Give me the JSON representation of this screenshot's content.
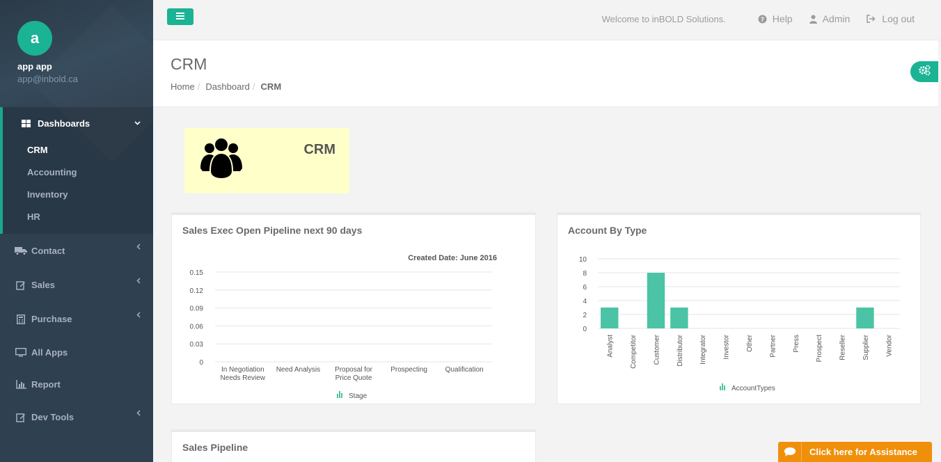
{
  "profile": {
    "initial": "a",
    "name": "app app",
    "email": "app@inbold.ca"
  },
  "sidebar": {
    "dashboards_label": "Dashboards",
    "sub_items": [
      "CRM",
      "Accounting",
      "Inventory",
      "HR"
    ],
    "items": [
      {
        "label": "Contact",
        "icon": "truck-icon",
        "chevron": true
      },
      {
        "label": "Sales",
        "icon": "edit-icon",
        "chevron": true
      },
      {
        "label": "Purchase",
        "icon": "calculator-icon",
        "chevron": true
      },
      {
        "label": "All Apps",
        "icon": "desktop-icon",
        "chevron": false
      },
      {
        "label": "Report",
        "icon": "bar-chart-icon",
        "chevron": false
      },
      {
        "label": "Dev Tools",
        "icon": "edit-icon",
        "chevron": true
      }
    ]
  },
  "topbar": {
    "welcome": "Welcome to inBOLD Solutions.",
    "help": "Help",
    "admin": "Admin",
    "logout": "Log out"
  },
  "heading": {
    "title": "CRM",
    "breadcrumb": [
      "Home",
      "Dashboard",
      "CRM"
    ]
  },
  "crm_widget": {
    "label": "CRM"
  },
  "panels": {
    "pipeline_title": "Sales Exec Open Pipeline next 90 days",
    "account_title": "Account By Type",
    "sales_pipeline_title": "Sales Pipeline"
  },
  "assist": {
    "label": "Click here for Assistance"
  },
  "colors": {
    "accent": "#1ab394",
    "sidebar": "#2f4050",
    "bar": "#4bc4a5",
    "assist": "#f0900a",
    "widget_bg": "#ffffc9"
  },
  "chart_data": [
    {
      "type": "bar",
      "title": "Sales Exec Open Pipeline next 90 days",
      "subtitle": "Created Date: June 2016",
      "categories": [
        "In Negotiation Needs Review",
        "Need Analysis",
        "Proposal for Price Quote",
        "Prospecting",
        "Qualification"
      ],
      "category_lines": [
        [
          "In Negotiation",
          "Needs Review"
        ],
        [
          "Need Analysis"
        ],
        [
          "Proposal for",
          "Price Quote"
        ],
        [
          "Prospecting"
        ],
        [
          "Qualification"
        ]
      ],
      "values": [
        0,
        0,
        0,
        0,
        0
      ],
      "yticks": [
        "0",
        "0.03",
        "0.06",
        "0.09",
        "0.12",
        "0.15"
      ],
      "ylim": [
        0,
        0.15
      ],
      "legend": "Stage",
      "grid": true
    },
    {
      "type": "bar",
      "title": "Account By Type",
      "categories": [
        "Analyst",
        "Competitor",
        "Customer",
        "Distributor",
        "Integrator",
        "Investor",
        "Other",
        "Partner",
        "Press",
        "Prospect",
        "Reseller",
        "Supplier",
        "Vendor"
      ],
      "values": [
        3,
        0,
        8,
        3,
        0,
        0,
        0,
        0,
        0,
        0,
        0,
        3,
        0
      ],
      "yticks": [
        "0",
        "2",
        "4",
        "6",
        "8",
        "10"
      ],
      "ylim": [
        0,
        10
      ],
      "legend": "AccountTypes",
      "grid": true
    }
  ]
}
